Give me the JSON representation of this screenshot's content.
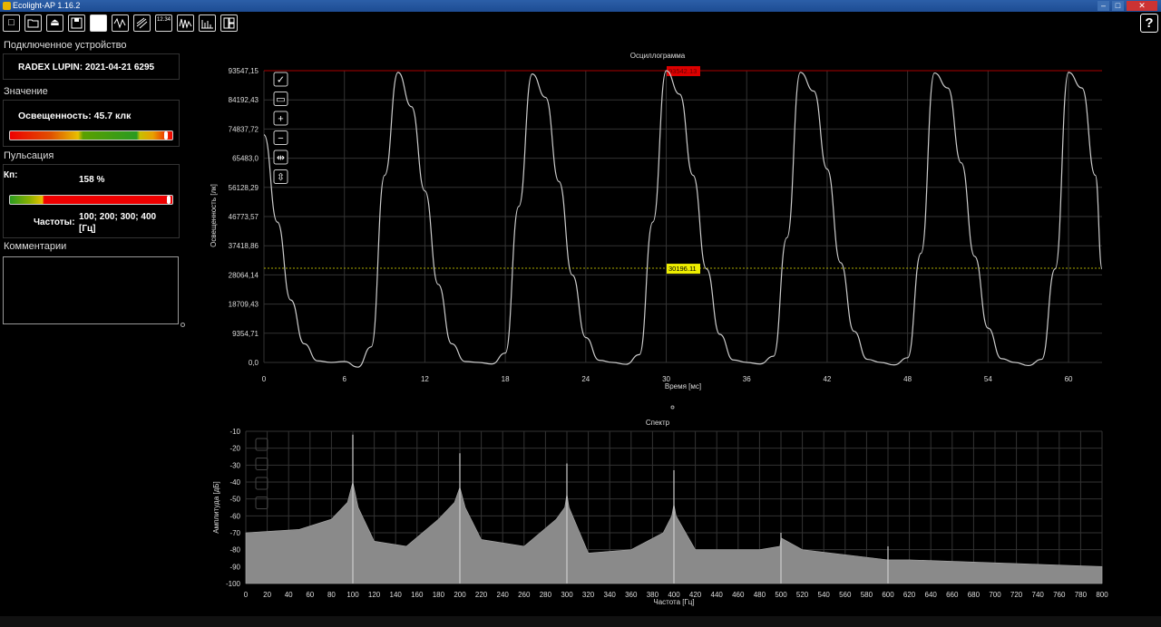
{
  "window": {
    "title": "Ecolight-AP 1.16.2",
    "minimize": "–",
    "maximize": "□",
    "close": "✕"
  },
  "toolbar": {
    "buttons": [
      {
        "name": "new-icon",
        "glyph": "□"
      },
      {
        "name": "open-folder-icon",
        "glyph": "📂"
      },
      {
        "name": "eject-icon",
        "glyph": "⏏"
      },
      {
        "name": "save-icon",
        "glyph": "💾"
      },
      {
        "name": "stop-icon",
        "glyph": "■"
      },
      {
        "name": "oscillogram-icon",
        "glyph": "⌇"
      },
      {
        "name": "calibrate-icon",
        "glyph": "≋"
      },
      {
        "name": "value-display-icon",
        "glyph": "12.34"
      },
      {
        "name": "waveform-icon",
        "glyph": "∿"
      },
      {
        "name": "spectrum-icon",
        "glyph": "▥"
      },
      {
        "name": "layout-icon",
        "glyph": "◫"
      }
    ],
    "help": "?"
  },
  "device": {
    "section_title": "Подключенное устройство",
    "name": "RADEX LUPIN: 2021-04-21 6295"
  },
  "value": {
    "section_title": "Значение",
    "text": "Освещенность: 45.7 клк",
    "level": 0.97
  },
  "pulsation": {
    "section_title": "Пульсация",
    "kp_label": "Кп:",
    "kp_value": "158 %",
    "level": 0.99,
    "freq_label": "Частоты:",
    "freq_value_line1": "100; 200; 300; 400",
    "freq_value_line2": "[Гц]"
  },
  "comments": {
    "section_title": "Комментарии"
  },
  "oscillogram": {
    "title": "Осциллограмма",
    "xlabel": "Время [мс]",
    "ylabel": "Освещенность [лк]",
    "y_ticks": [
      "93547,15",
      "84192,43",
      "74837,72",
      "65483,0",
      "56128,29",
      "46773,57",
      "37418,86",
      "28064,14",
      "18709,43",
      "9354,71",
      "0,0"
    ],
    "x_ticks": [
      "0",
      "6",
      "12",
      "18",
      "24",
      "30",
      "36",
      "42",
      "48",
      "54",
      "60"
    ],
    "max_label": "93542.13",
    "avg_label": "30196.11",
    "tool_icons": [
      "autoscale-icon",
      "fit-icon",
      "zoom-in-icon",
      "zoom-out-icon",
      "pan-horizontal-icon",
      "pan-vertical-icon"
    ]
  },
  "spectrum": {
    "title": "Спектр",
    "xlabel": "Частота [Гц]",
    "ylabel": "Амплитуда [дБ]",
    "y_ticks": [
      "-10",
      "-20",
      "-30",
      "-40",
      "-50",
      "-60",
      "-70",
      "-80",
      "-90",
      "-100"
    ],
    "x_ticks": [
      "0",
      "20",
      "40",
      "60",
      "80",
      "100",
      "120",
      "140",
      "160",
      "180",
      "200",
      "220",
      "240",
      "260",
      "280",
      "300",
      "320",
      "340",
      "360",
      "380",
      "400",
      "420",
      "440",
      "460",
      "480",
      "500",
      "520",
      "540",
      "560",
      "580",
      "600",
      "620",
      "640",
      "660",
      "680",
      "700",
      "720",
      "740",
      "760",
      "780",
      "800"
    ]
  },
  "chart_data": [
    {
      "type": "line",
      "title": "Осциллограмма",
      "xlabel": "Время [мс]",
      "ylabel": "Освещенность [лк]",
      "xlim": [
        0,
        62.5
      ],
      "ylim": [
        -2000,
        93547.15
      ],
      "series": [
        {
          "values_x": [
            0,
            1,
            2,
            3,
            4,
            5,
            6,
            7,
            8,
            9,
            10,
            11,
            12,
            13,
            14,
            15,
            16,
            17,
            18,
            19,
            20,
            21,
            22,
            23,
            24,
            25,
            26,
            27,
            28,
            29,
            30,
            31,
            32,
            33,
            34,
            35,
            36,
            37,
            38,
            39,
            40,
            41,
            42,
            43,
            44,
            45,
            46,
            47,
            48,
            49,
            50,
            51,
            52,
            53,
            54,
            55,
            56,
            57,
            58,
            59,
            60,
            61,
            62,
            62.5
          ],
          "values_y": [
            73000,
            45000,
            20000,
            6000,
            500,
            0,
            300,
            -1500,
            5000,
            60000,
            93000,
            82000,
            55000,
            25000,
            6000,
            300,
            0,
            -500,
            3000,
            50000,
            92500,
            85000,
            58000,
            28000,
            8000,
            700,
            0,
            -600,
            2500,
            45000,
            93542,
            86000,
            60000,
            30000,
            9000,
            800,
            0,
            -500,
            2000,
            40000,
            93000,
            87000,
            62000,
            32000,
            10000,
            1000,
            0,
            -800,
            1500,
            35000,
            92800,
            88000,
            64000,
            34000,
            11000,
            1200,
            0,
            -1000,
            1000,
            30000,
            93000,
            88000,
            60000,
            30000
          ]
        }
      ],
      "annotations": {
        "max": 93542.13,
        "average": 30196.11
      }
    },
    {
      "type": "bar",
      "title": "Спектр",
      "xlabel": "Частота [Гц]",
      "ylabel": "Амплитуда [дБ]",
      "xlim": [
        0,
        800
      ],
      "ylim": [
        -100,
        -10
      ],
      "peaks": [
        {
          "x": 100,
          "y": -12
        },
        {
          "x": 200,
          "y": -23
        },
        {
          "x": 300,
          "y": -29
        },
        {
          "x": 400,
          "y": -33
        },
        {
          "x": 500,
          "y": -70
        },
        {
          "x": 600,
          "y": -78
        }
      ],
      "envelope_x": [
        0,
        50,
        80,
        95,
        100,
        105,
        120,
        150,
        180,
        195,
        200,
        205,
        220,
        260,
        290,
        298,
        300,
        302,
        320,
        360,
        390,
        398,
        400,
        402,
        420,
        480,
        499,
        500,
        520,
        600,
        620,
        800
      ],
      "envelope_y": [
        -70,
        -68,
        -62,
        -52,
        -40,
        -55,
        -75,
        -78,
        -62,
        -52,
        -43,
        -55,
        -74,
        -78,
        -62,
        -55,
        -47,
        -55,
        -82,
        -80,
        -70,
        -60,
        -53,
        -60,
        -80,
        -80,
        -78,
        -73,
        -80,
        -86,
        -86,
        -90
      ]
    }
  ]
}
